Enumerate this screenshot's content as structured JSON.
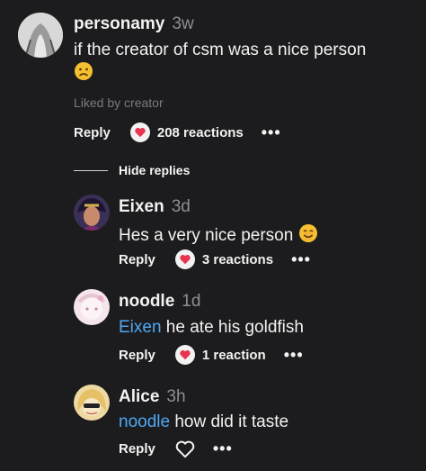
{
  "comment": {
    "username": "personamy",
    "time": "3w",
    "text": "if the creator of csm was a nice person",
    "liked_note": "Liked by creator",
    "reply_label": "Reply",
    "reactions": "208 reactions",
    "more": "•••"
  },
  "hide_replies_label": "Hide replies",
  "replies": [
    {
      "username": "Eixen",
      "time": "3d",
      "text": "Hes a very nice person",
      "reply_label": "Reply",
      "reactions": "3 reactions",
      "more": "•••"
    },
    {
      "username": "noodle",
      "time": "1d",
      "mention": "Eixen",
      "text": " he ate his goldfish",
      "reply_label": "Reply",
      "reactions": "1 reaction",
      "more": "•••"
    },
    {
      "username": "Alice",
      "time": "3h",
      "mention": "noodle",
      "text": " how did it taste",
      "reply_label": "Reply",
      "more": "•••"
    }
  ],
  "colors": {
    "background": "#1c1c1e",
    "mention": "#4ea8f5",
    "heart": "#e8344e"
  }
}
